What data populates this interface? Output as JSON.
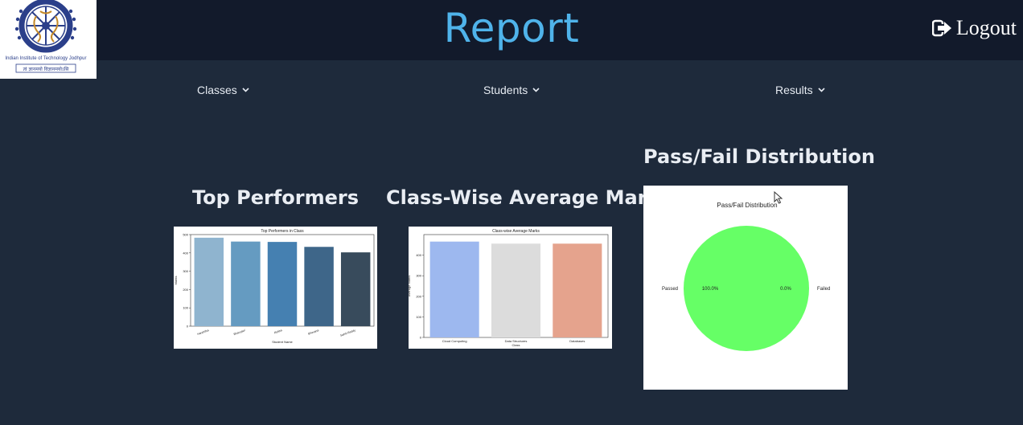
{
  "header": {
    "title": "Report",
    "logout_label": "Logout",
    "logo_text_top": "भारतीय प्रौद्योगिकी संस्थान",
    "logo_text_bottom": "Indian Institute of Technology Jodhpur",
    "logo_motto": "त्वं ज्ञानमयो विज्ञानमयोऽसि"
  },
  "nav": {
    "items": [
      {
        "label": "Classes"
      },
      {
        "label": "Students"
      },
      {
        "label": "Results"
      }
    ]
  },
  "sections": {
    "top_performers": "Top Performers",
    "class_average": "Class-Wise Average Marks",
    "pass_fail": "Pass/Fail Distribution"
  },
  "chart_data": [
    {
      "type": "bar",
      "title": "Top Performers in Class",
      "xlabel": "Student Name",
      "ylabel": "Marks",
      "categories": [
        "Harshitha",
        "Bhavyasri",
        "Rekha",
        "Bhavana",
        "Sahiti Reddy"
      ],
      "values": [
        483,
        462,
        460,
        433,
        403
      ],
      "ylim": [
        0,
        500
      ],
      "yticks": [
        0,
        100,
        200,
        300,
        400,
        500
      ],
      "colors": [
        "#8fb4cf",
        "#659bc1",
        "#4580b1",
        "#3e6689",
        "#384b5c"
      ]
    },
    {
      "type": "bar",
      "title": "Class-wise Average Marks",
      "xlabel": "Class",
      "ylabel": "Average Marks",
      "categories": [
        "Cloud Computing",
        "Data Structures",
        "Databases"
      ],
      "values": [
        466,
        456,
        456
      ],
      "ylim": [
        0,
        500
      ],
      "yticks": [
        0,
        100,
        200,
        300,
        400
      ],
      "colors": [
        "#9db8ef",
        "#dcdcdc",
        "#e5a38d"
      ]
    },
    {
      "type": "pie",
      "title": "Pass/Fail Distribution",
      "labels": [
        "Passed",
        "Failed"
      ],
      "values": [
        100.0,
        0.0
      ],
      "value_labels": [
        "100.0%",
        "0.0%"
      ],
      "colors": [
        "#66ff66",
        "#ff6666"
      ]
    }
  ]
}
